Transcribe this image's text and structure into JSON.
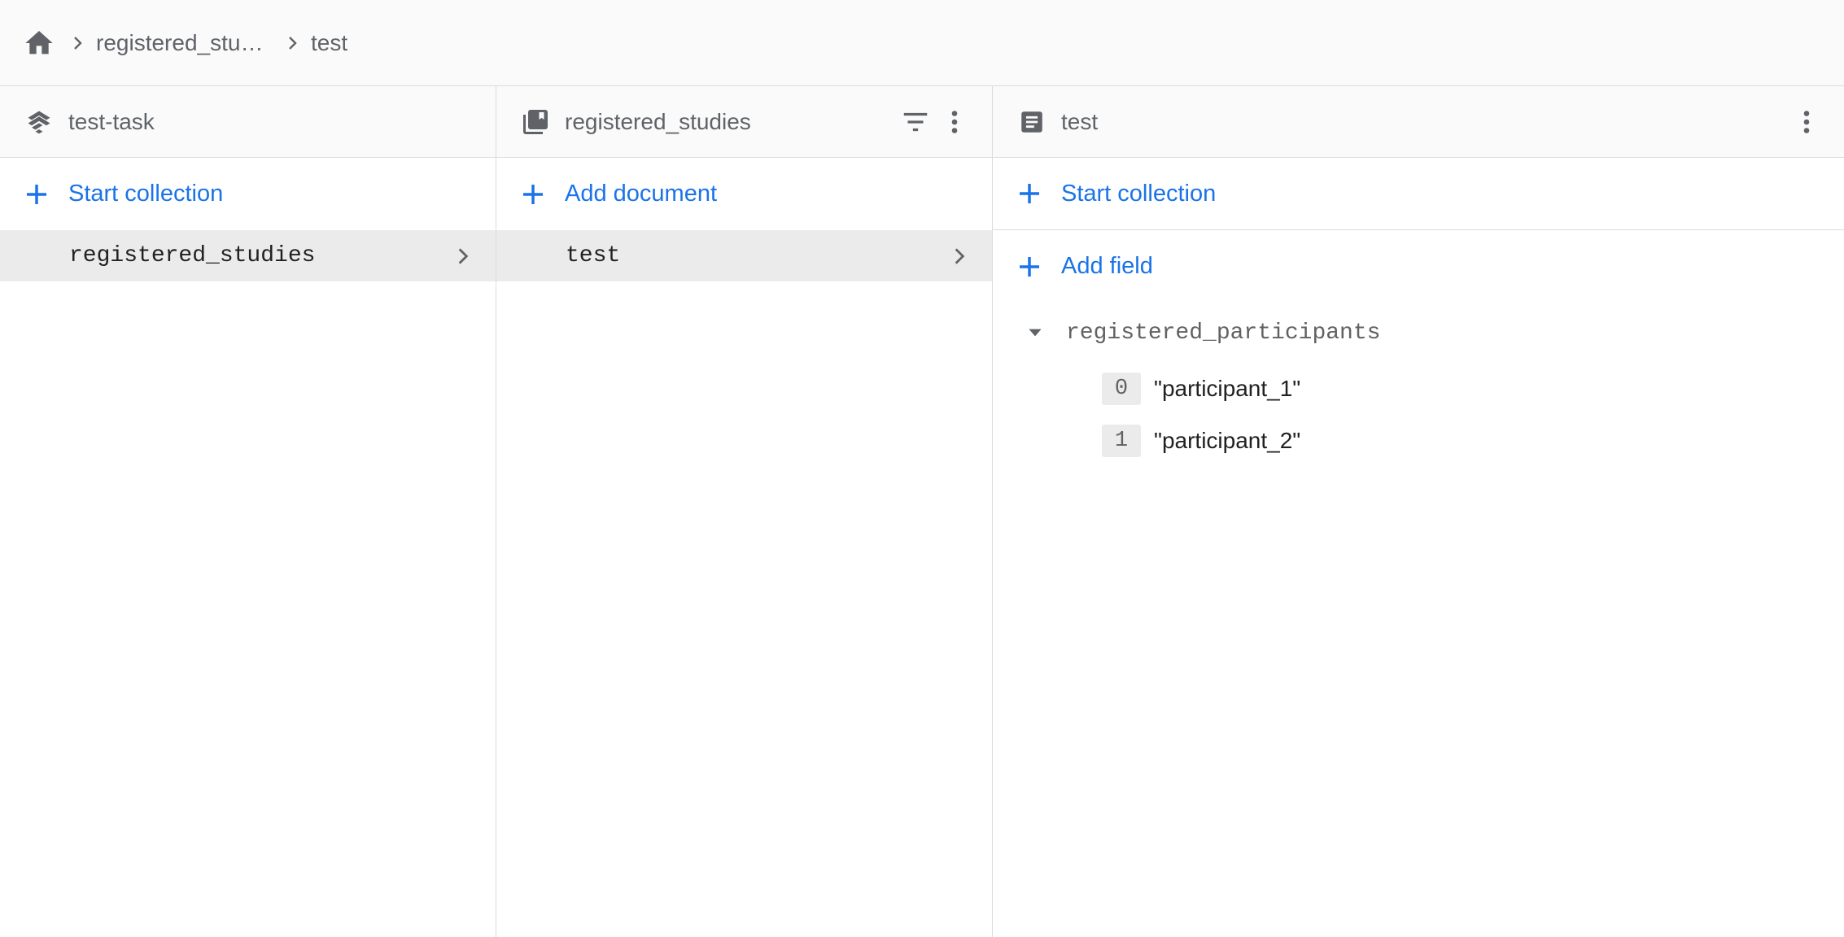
{
  "breadcrumb": {
    "items": [
      {
        "label": "registered_studi…"
      },
      {
        "label": "test"
      }
    ]
  },
  "columns": {
    "root": {
      "title": "test-task",
      "action_label": "Start collection",
      "items": [
        {
          "label": "registered_studies"
        }
      ]
    },
    "collection": {
      "title": "registered_studies",
      "action_label": "Add document",
      "items": [
        {
          "label": "test"
        }
      ]
    },
    "document": {
      "title": "test",
      "start_collection_label": "Start collection",
      "add_field_label": "Add field",
      "field": {
        "name": "registered_participants",
        "entries": [
          {
            "index": "0",
            "value": "\"participant_1\""
          },
          {
            "index": "1",
            "value": "\"participant_2\""
          }
        ]
      }
    }
  },
  "colors": {
    "accent": "#1a73e8",
    "icon_gray": "#5f6368",
    "selected_bg": "#ebebeb",
    "header_bg": "#fafafa"
  }
}
